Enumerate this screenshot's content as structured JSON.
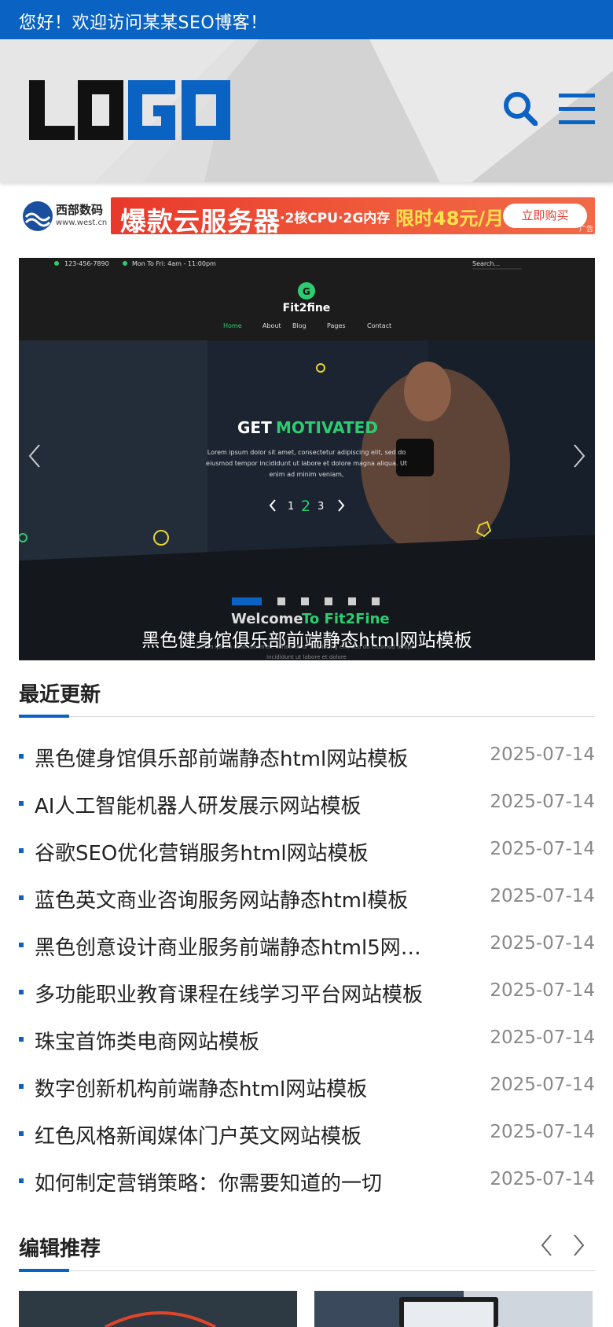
{
  "topbar": {
    "welcome": "您好！欢迎访问某某SEO博客！"
  },
  "header": {
    "logo_text": "LOGO"
  },
  "ad": {
    "brand_name": "西部数码",
    "brand_url": "www.west.cn",
    "headline": "爆款云服务器",
    "spec": "·2核CPU·2G内存",
    "price": "限时48元/月",
    "button": "立即购买",
    "tag": "广告"
  },
  "slider": {
    "caption": "黑色健身馆俱乐部前端静态html网站模板",
    "active_dot": 1,
    "dot_count": 6,
    "screenshot": {
      "phone": "123-456-7890",
      "hours": "Mon To Fri: 4am - 11:00pm",
      "search": "Search...",
      "brand": "Fit2fine",
      "nav": [
        "Home",
        "About",
        "Blog",
        "Pages",
        "Contact"
      ],
      "hero_word1": "GET",
      "hero_word2": "MOTIVATED",
      "hero_text1": "Lorem ipsum dolor sit amet, consectetur adipiscing elit, sed do",
      "hero_text2": "eiusmod tempor incididunt ut labore et dolore magna aliqua. Ut",
      "hero_text3": "enim ad minim veniam,",
      "pager": [
        "1",
        "2",
        "3"
      ],
      "welcome1": "Welcome",
      "welcome2": "To Fit2Fine",
      "welcome_sub1": "Lorem ipsum dolor sit amet, consectetur adipiscing elit, sed do eiusmod tempor",
      "welcome_sub2": "incididunt ut labore et dolore"
    }
  },
  "recent": {
    "title": "最近更新",
    "items": [
      {
        "title": "黑色健身馆俱乐部前端静态html网站模板",
        "date": "2025-07-14"
      },
      {
        "title": "AI人工智能机器人研发展示网站模板",
        "date": "2025-07-14"
      },
      {
        "title": "谷歌SEO优化营销服务html网站模板",
        "date": "2025-07-14"
      },
      {
        "title": "蓝色英文商业咨询服务网站静态html模板",
        "date": "2025-07-14"
      },
      {
        "title": "黑色创意设计商业服务前端静态html5网…",
        "date": "2025-07-14"
      },
      {
        "title": "多功能职业教育课程在线学习平台网站模板",
        "date": "2025-07-14"
      },
      {
        "title": "珠宝首饰类电商网站模板",
        "date": "2025-07-14"
      },
      {
        "title": "数字创新机构前端静态html网站模板",
        "date": "2025-07-14"
      },
      {
        "title": "红色风格新闻媒体门户英文网站模板",
        "date": "2025-07-14"
      },
      {
        "title": "如何制定营销策略：你需要知道的一切",
        "date": "2025-07-14"
      }
    ]
  },
  "editor": {
    "title": "编辑推荐"
  },
  "colors": {
    "primary": "#0a63c2",
    "date": "#888888",
    "ad_red": "#e8392c",
    "ad_yellow": "#ffe14d",
    "fit_green": "#2ecc71"
  }
}
